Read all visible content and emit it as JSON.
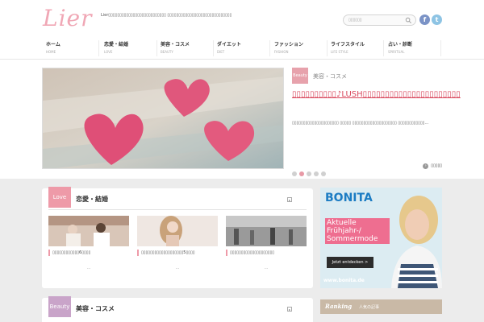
{
  "header": {
    "logo": "Lier",
    "tagline": "Lier▯▯▯▯▯▯▯▯▯▯▯▯▯▯▯▯▯▯▯▯▯▯▯▯▯▯ ▯▯▯▯▯▯▯▯▯▯▯▯▯▯▯▯▯▯▯▯▯▯▯▯▯▯▯▯▯",
    "search_placeholder": "▯▯▯▯▯▯",
    "facebook_glyph": "f",
    "twitter_glyph": "t"
  },
  "nav": [
    {
      "jp": "ホーム",
      "en": "HOME"
    },
    {
      "jp": "恋愛・結婚",
      "en": "LOVE"
    },
    {
      "jp": "美容・コスメ",
      "en": "BEAUTY"
    },
    {
      "jp": "ダイエット",
      "en": "DIET"
    },
    {
      "jp": "ファッション",
      "en": "FASHION"
    },
    {
      "jp": "ライフスタイル",
      "en": "LIFE STYLE"
    },
    {
      "jp": "占い・診断",
      "en": "SPIRITUAL"
    }
  ],
  "slider": {
    "badge": "Beauty",
    "category": "美容・コスメ",
    "title": "▯▯▯▯▯▯▯▯▯▯♪LUSH▯▯▯▯▯▯▯▯▯▯▯▯▯▯▯▯▯▯▯▯▯▯",
    "excerpt": "▯▯▯▯▯▯▯▯▯▯▯▯▯▯▯▯▯▯▯▯▯ ▯▯▯▯▯ ▯▯▯▯▯▯▯▯▯▯▯▯▯▯▯▯▯▯▯▯ ▯▯▯▯▯▯▯▯▯▯▯▯…",
    "dot_count": 5,
    "active_dot": 1,
    "more_label": "▯▯▯▯▯"
  },
  "love_panel": {
    "badge": "Love",
    "title": "恋愛・結婚",
    "articles": [
      {
        "title": "▯▯▯▯▯▯▯▯▯▯▯▯6▯▯▯▯",
        "more": "…"
      },
      {
        "title": "▯▯▯▯▯▯▯▯▯▯▯▯▯▯▯▯▯▯▯5▯▯▯▯",
        "more": "…"
      },
      {
        "title": "▯▯▯▯▯▯▯▯▯▯▯▯▯▯▯▯▯▯▯▯",
        "more": "…"
      }
    ]
  },
  "beauty_panel": {
    "badge": "Beauty",
    "title": "美容・コスメ"
  },
  "ad": {
    "brand": "BONITA",
    "copy": "Aktuelle Frühjahr-/ Sommermode",
    "button": "Jetzt entdecken >",
    "url": "www.bonita.de"
  },
  "ranking": {
    "label_en": "Ranking",
    "label_jp": "人気の記事"
  },
  "colors": {
    "accent_pink": "#e7a2ac",
    "title_red": "#d9485d",
    "beauty_purple": "#c9a4c9",
    "ranking_tan": "#c9b9a6"
  }
}
